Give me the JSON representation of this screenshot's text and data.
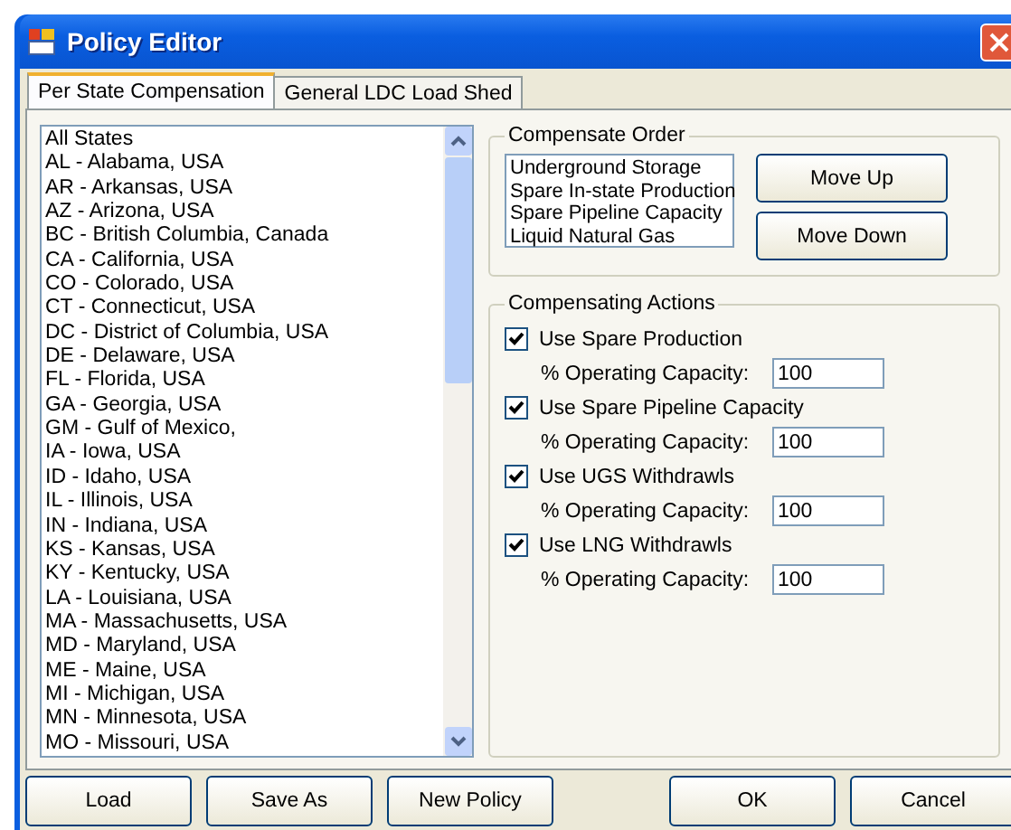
{
  "window": {
    "title": "Policy Editor"
  },
  "tabs": [
    {
      "label": "Per State Compensation",
      "selected": true
    },
    {
      "label": "General LDC Load Shed",
      "selected": false
    }
  ],
  "states": [
    "All States",
    "AL - Alabama, USA",
    "AR - Arkansas, USA",
    "AZ - Arizona, USA",
    "BC - British Columbia, Canada",
    "CA - California, USA",
    "CO - Colorado, USA",
    "CT - Connecticut, USA",
    "DC - District of Columbia, USA",
    "DE - Delaware, USA",
    "FL - Florida, USA",
    "GA - Georgia, USA",
    "GM - Gulf of Mexico,",
    "IA - Iowa, USA",
    "ID - Idaho, USA",
    "IL - Illinois, USA",
    "IN - Indiana, USA",
    "KS - Kansas, USA",
    "KY - Kentucky, USA",
    "LA - Louisiana, USA",
    "MA - Massachusetts, USA",
    "MD - Maryland, USA",
    "ME - Maine, USA",
    "MI - Michigan, USA",
    "MN - Minnesota, USA",
    "MO - Missouri, USA"
  ],
  "compensate_order": {
    "title": "Compensate Order",
    "items": [
      "Underground Storage",
      "Spare In-state Production",
      "Spare Pipeline Capacity",
      "Liquid Natural Gas"
    ],
    "buttons": [
      "Move Up",
      "Move Down"
    ]
  },
  "compensating_actions": {
    "title": "Compensating Actions",
    "actions": [
      {
        "label": "Use Spare Production",
        "checked": true,
        "capacity": {
          "label": "% Operating Capacity:",
          "value": "100"
        }
      },
      {
        "label": "Use Spare Pipeline Capacity",
        "checked": true,
        "capacity": {
          "label": "% Operating Capacity:",
          "value": "100"
        }
      },
      {
        "label": "Use UGS Withdrawls",
        "checked": true,
        "capacity": {
          "label": "% Operating Capacity:",
          "value": "100"
        }
      },
      {
        "label": "Use LNG Withdrawls",
        "checked": true,
        "capacity": {
          "label": "% Operating Capacity:",
          "value": "100"
        }
      }
    ]
  },
  "buttons_left": [
    "Load",
    "Save As",
    "New Policy"
  ],
  "buttons_right": [
    "OK",
    "Cancel"
  ]
}
